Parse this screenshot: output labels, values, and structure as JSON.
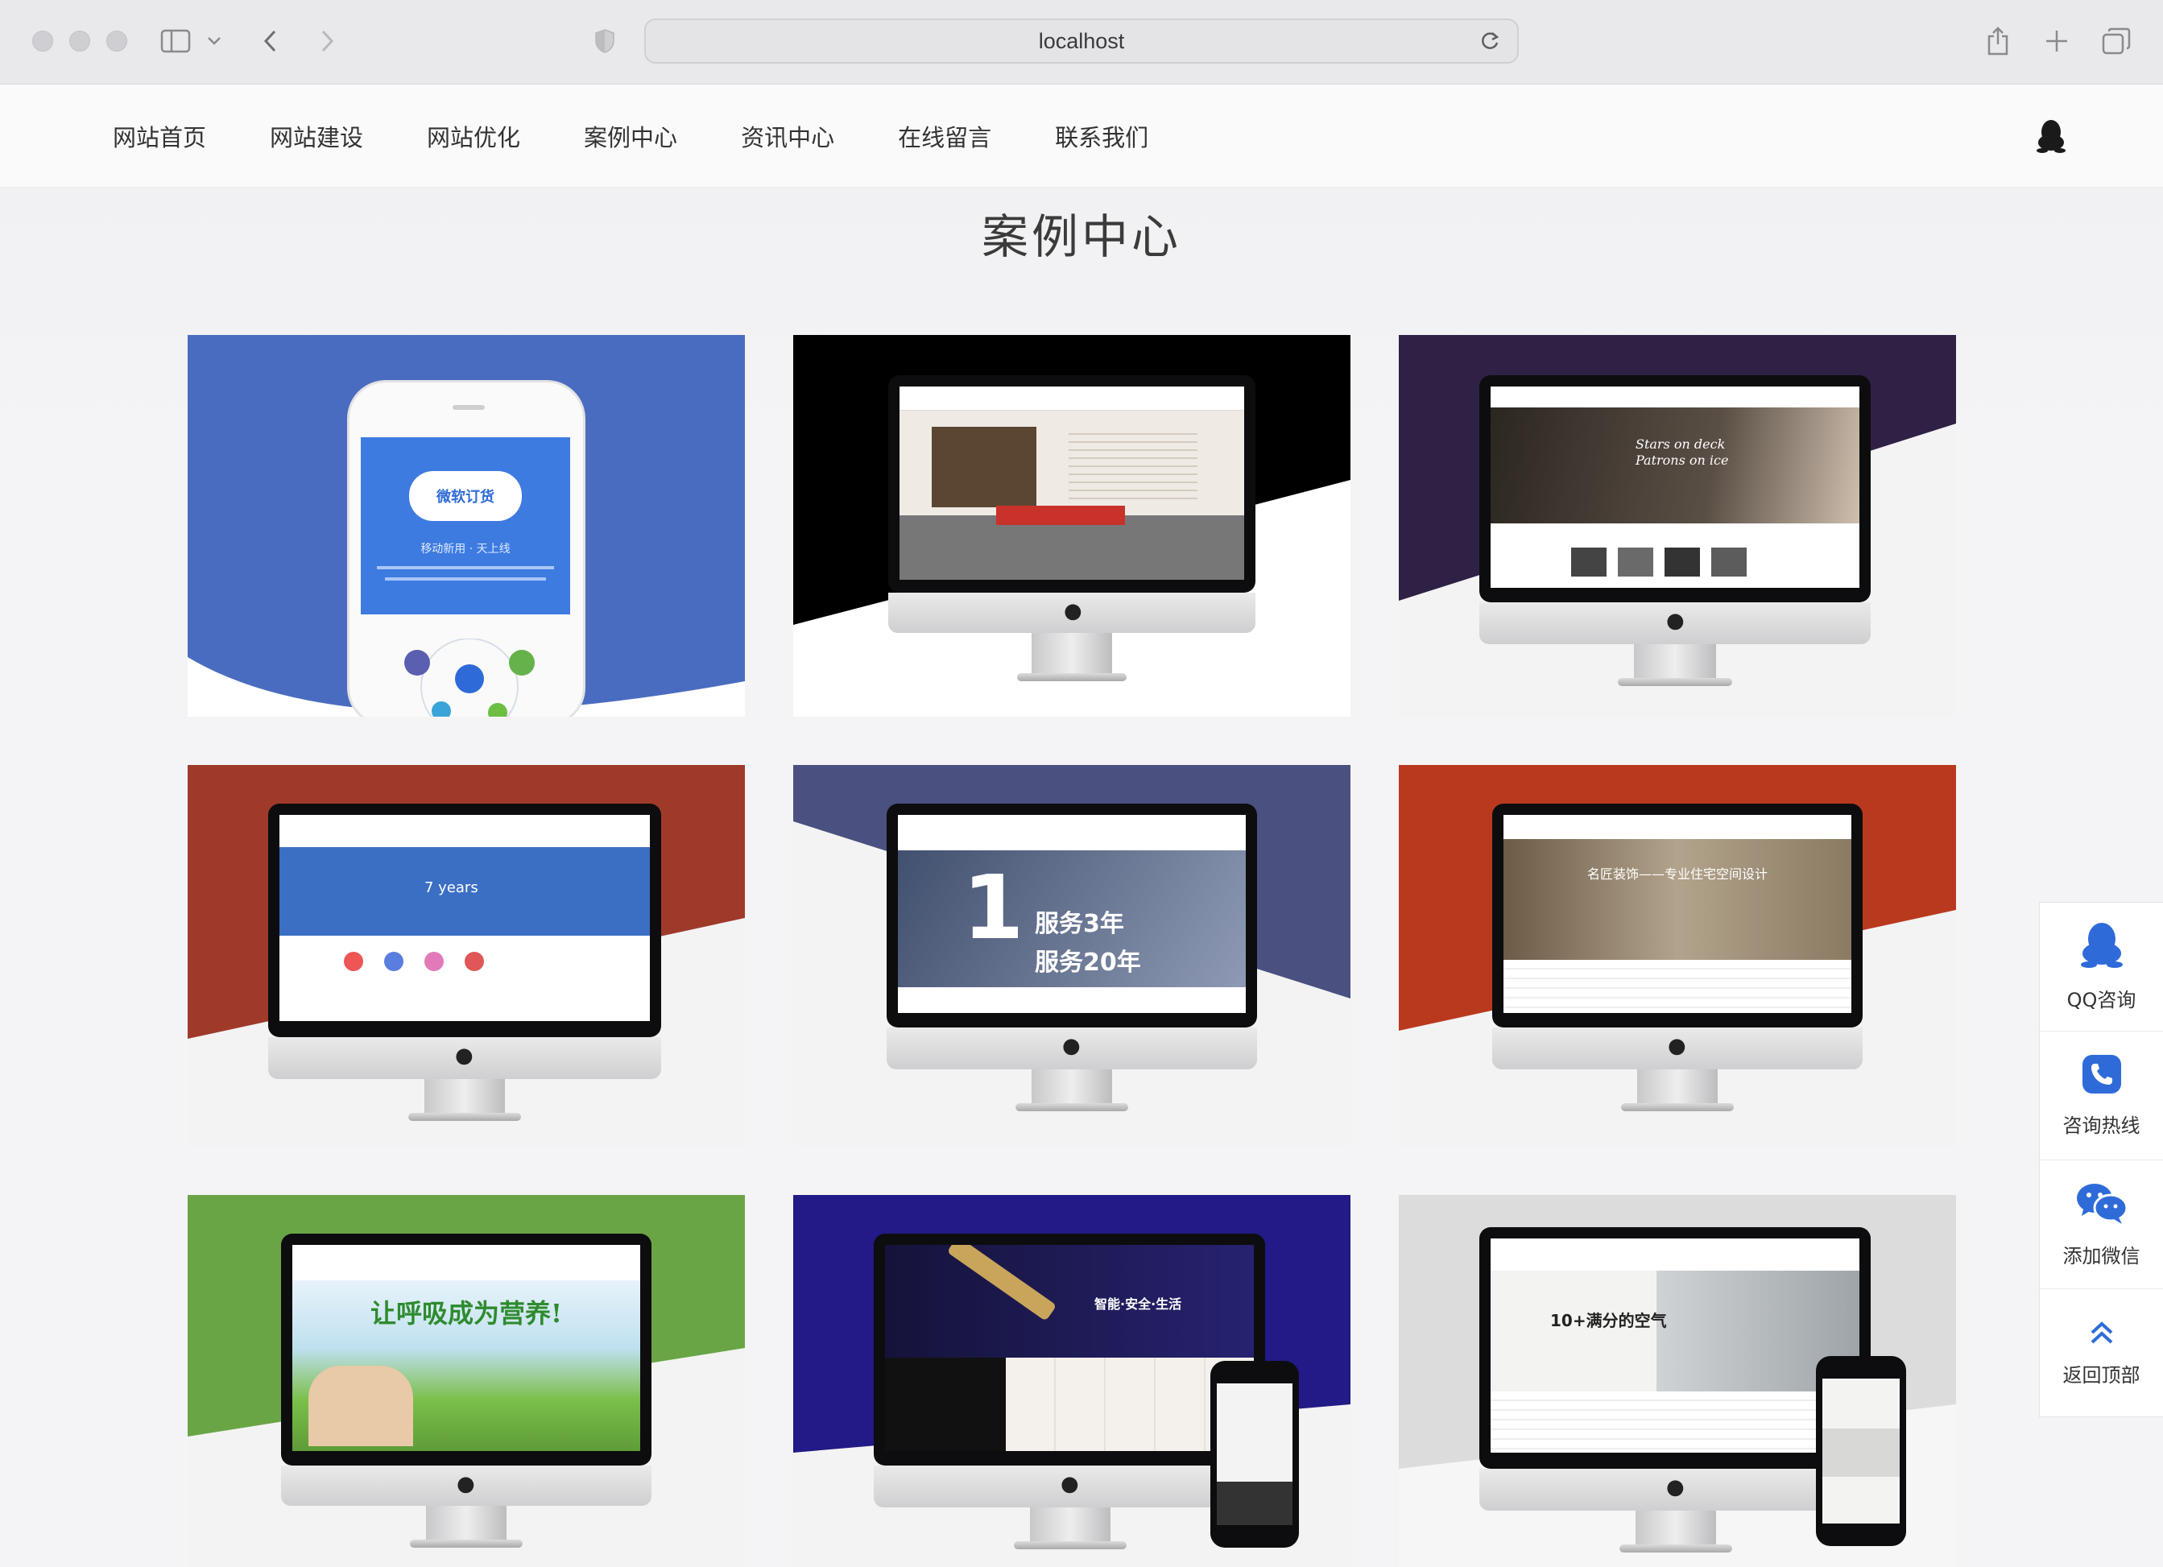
{
  "browser": {
    "url": "localhost"
  },
  "nav": {
    "items": [
      "网站首页",
      "网站建设",
      "网站优化",
      "案例中心",
      "资讯中心",
      "在线留言",
      "联系我们"
    ]
  },
  "page": {
    "title": "案例中心"
  },
  "cases": [
    {
      "bg": "#4a6cc0",
      "device": "phone",
      "screen_text_1": "微软订货",
      "screen_text_2": "移动新用 · 天上线"
    },
    {
      "bg": "#000000",
      "device": "imac",
      "screen_color": "#efeae4",
      "screen_text_1": "",
      "screen_text_2": ""
    },
    {
      "bg": "#2e2145",
      "device": "imac",
      "screen_color": "#3a342f",
      "screen_text_1": "Stars on deck",
      "screen_text_2": "Patrons on ice"
    },
    {
      "bg": "#9f3a2b",
      "device": "imac",
      "screen_color": "#3b6fc4",
      "screen_text_1": "7 years",
      "screen_text_2": ""
    },
    {
      "bg": "#4a5180",
      "device": "imac",
      "screen_color": "#41506e",
      "screen_text_1": "服务3年",
      "screen_text_2": "服务20年"
    },
    {
      "bg": "#b9391f",
      "device": "imac",
      "screen_color": "#8b7a63",
      "screen_text_1": "名匠装饰——专业住宅空间设计",
      "screen_text_2": ""
    },
    {
      "bg": "#6aa545",
      "device": "imac",
      "screen_color": "#7bbf4a",
      "screen_text_1": "让呼吸成为营养!",
      "screen_text_2": ""
    },
    {
      "bg": "#221a86",
      "device": "imac",
      "screen_color": "#1d1b3a",
      "screen_text_1": "智能·安全·生活",
      "screen_text_2": ""
    },
    {
      "bg": "#dcdcdc",
      "device": "imac",
      "screen_color": "#f3f3f1",
      "screen_text_1": "10+满分的空气",
      "screen_text_2": ""
    }
  ],
  "float": {
    "items": [
      {
        "label": "QQ咨询",
        "icon": "qq-icon"
      },
      {
        "label": "咨询热线",
        "icon": "phone-icon"
      },
      {
        "label": "添加微信",
        "icon": "wechat-icon"
      },
      {
        "label": "返回顶部",
        "icon": "up-chevron-icon"
      }
    ]
  },
  "colors": {
    "accent": "#2f6bd8",
    "nav_text": "#333333"
  }
}
